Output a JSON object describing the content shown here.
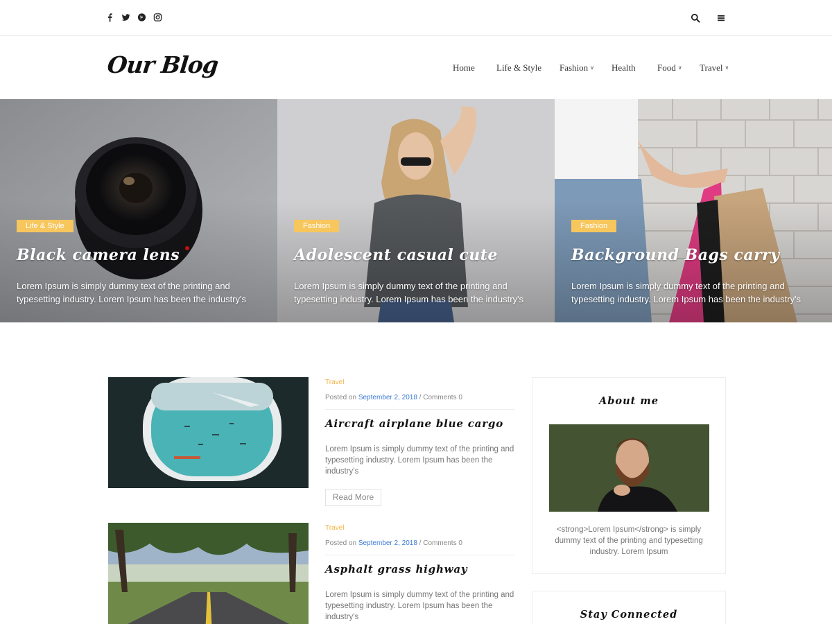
{
  "topbar": {
    "social_icons": [
      "facebook-icon",
      "twitter-icon",
      "pinterest-icon",
      "instagram-icon"
    ],
    "right_icons": [
      "search-icon",
      "hamburger-menu-icon"
    ]
  },
  "header": {
    "logo": "Our Blog",
    "nav": [
      {
        "label": "Home",
        "has_dropdown": false
      },
      {
        "label": "Life & Style",
        "has_dropdown": false
      },
      {
        "label": "Fashion",
        "has_dropdown": true
      },
      {
        "label": "Health",
        "has_dropdown": false
      },
      {
        "label": "Food",
        "has_dropdown": true
      },
      {
        "label": "Travel",
        "has_dropdown": true
      }
    ]
  },
  "hero": {
    "slides": [
      {
        "category": "Life & Style",
        "title": "Black camera lens",
        "excerpt": "Lorem Ipsum is simply dummy text of the printing and typesetting industry. Lorem Ipsum has been the industry's"
      },
      {
        "category": "Fashion",
        "title": "Adolescent casual cute",
        "excerpt": "Lorem Ipsum is simply dummy text of the printing and typesetting industry. Lorem Ipsum has been the industry's"
      },
      {
        "category": "Fashion",
        "title": "Background Bags carry",
        "excerpt": "Lorem Ipsum is simply dummy text of the printing and typesetting industry. Lorem Ipsum has been the industry's"
      }
    ]
  },
  "posts": [
    {
      "category": "Travel",
      "posted_on": "Posted on",
      "date": "September 2, 2018",
      "separator": "/",
      "comments": "Comments 0",
      "title": "Aircraft airplane blue cargo",
      "excerpt": "Lorem Ipsum is simply dummy text of the printing and typesetting industry. Lorem Ipsum has been the industry's",
      "read_more": "Read More"
    },
    {
      "category": "Travel",
      "posted_on": "Posted on",
      "date": "September 2, 2018",
      "separator": "/",
      "comments": "Comments 0",
      "title": "Asphalt grass highway",
      "excerpt": "Lorem Ipsum is simply dummy text of the printing and typesetting industry. Lorem Ipsum has been the industry's"
    }
  ],
  "sidebar": {
    "about": {
      "title": "About me",
      "text": "<strong>Lorem Ipsum</strong> is simply dummy text of the printing and typesetting industry. Lorem Ipsum"
    },
    "stay_connected": {
      "title": "Stay Connected"
    }
  },
  "colors": {
    "accent": "#f7c65d",
    "link": "#3b7bd6",
    "category_text": "#f2b544"
  }
}
